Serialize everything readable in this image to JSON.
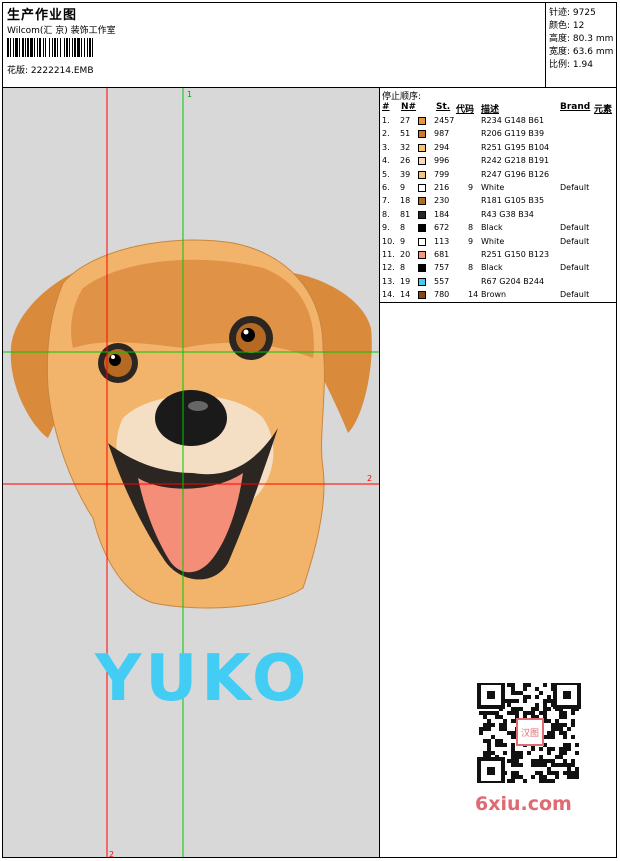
{
  "header": {
    "title": "生产作业图",
    "company": "Wilcom(汇 京) 装饰工作室",
    "design_label": "花版:",
    "design_file": "2222214.EMB"
  },
  "stats": [
    {
      "label": "针迹:",
      "value": "9725"
    },
    {
      "label": "颜色:",
      "value": "12"
    },
    {
      "label": "高度:",
      "value": "80.3 mm"
    },
    {
      "label": "宽度:",
      "value": "63.6 mm"
    },
    {
      "label": "比例:",
      "value": "1.94"
    }
  ],
  "sequence": {
    "title": "停止顺序:",
    "columns": [
      "#",
      "N#",
      "St.",
      "代码",
      "描述",
      "Brand",
      "元素"
    ],
    "rows": [
      {
        "idx": "1.",
        "n": "27",
        "st": "2457",
        "code": "",
        "desc": "R234 G148 B61",
        "brand": "",
        "color": "#EA943D"
      },
      {
        "idx": "2.",
        "n": "51",
        "st": "987",
        "code": "",
        "desc": "R206 G119 B39",
        "brand": "",
        "color": "#CE7727"
      },
      {
        "idx": "3.",
        "n": "32",
        "st": "294",
        "code": "",
        "desc": "R251 G195 B104",
        "brand": "",
        "color": "#FBC368"
      },
      {
        "idx": "4.",
        "n": "26",
        "st": "996",
        "code": "",
        "desc": "R242 G218 B191",
        "brand": "",
        "color": "#F2DABF"
      },
      {
        "idx": "5.",
        "n": "39",
        "st": "799",
        "code": "",
        "desc": "R247 G196 B126",
        "brand": "",
        "color": "#F7C47E"
      },
      {
        "idx": "6.",
        "n": "9",
        "st": "216",
        "code": "9",
        "desc": "White",
        "brand": "Default",
        "color": "#FFFFFF"
      },
      {
        "idx": "7.",
        "n": "18",
        "st": "230",
        "code": "",
        "desc": "R181 G105 B35",
        "brand": "",
        "color": "#B56923"
      },
      {
        "idx": "8.",
        "n": "81",
        "st": "184",
        "code": "",
        "desc": "R43 G38 B34",
        "brand": "",
        "color": "#2B2622"
      },
      {
        "idx": "9.",
        "n": "8",
        "st": "672",
        "code": "8",
        "desc": "Black",
        "brand": "Default",
        "color": "#000000"
      },
      {
        "idx": "10.",
        "n": "9",
        "st": "113",
        "code": "9",
        "desc": "White",
        "brand": "Default",
        "color": "#FFFFFF"
      },
      {
        "idx": "11.",
        "n": "20",
        "st": "681",
        "code": "",
        "desc": "R251 G150 B123",
        "brand": "",
        "color": "#FB967B"
      },
      {
        "idx": "12.",
        "n": "8",
        "st": "757",
        "code": "8",
        "desc": "Black",
        "brand": "Default",
        "color": "#000000"
      },
      {
        "idx": "13.",
        "n": "19",
        "st": "557",
        "code": "",
        "desc": "R67 G204 B244",
        "brand": "",
        "color": "#43CCF4"
      },
      {
        "idx": "14.",
        "n": "14",
        "st": "780",
        "code": "14",
        "desc": "Brown",
        "brand": "Default",
        "color": "#8B4513"
      }
    ]
  },
  "canvas": {
    "text": "YUKO",
    "marker_right": "2",
    "marker_bottom": "2",
    "marker_top": "1"
  },
  "watermark": {
    "site": "6xiu.com",
    "stamp": "汉图"
  }
}
